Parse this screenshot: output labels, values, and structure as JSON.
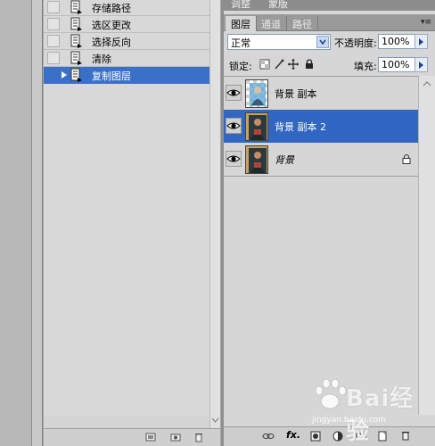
{
  "history": {
    "items": [
      {
        "label": "存储路径"
      },
      {
        "label": "选区更改"
      },
      {
        "label": "选择反向"
      },
      {
        "label": "清除"
      },
      {
        "label": "复制图层",
        "selected": true
      }
    ]
  },
  "layers_panel": {
    "top_tabs": [
      "调整",
      "蒙版"
    ],
    "tabs": [
      "图层",
      "通道",
      "路径"
    ],
    "blend_mode": "正常",
    "opacity_label": "不透明度:",
    "opacity_value": "100%",
    "lock_label": "锁定:",
    "fill_label": "填充:",
    "fill_value": "100%",
    "layers": [
      {
        "name": "背景 副本",
        "selected": false
      },
      {
        "name": "背景 副本 2",
        "selected": true
      },
      {
        "name": "背景",
        "selected": false,
        "locked": true
      }
    ]
  },
  "watermark": {
    "text": "Bai经验",
    "url": "jingyan.baidu.com"
  },
  "colors": {
    "selection": "#3166c2",
    "panel_bg": "#d6d6d6"
  }
}
